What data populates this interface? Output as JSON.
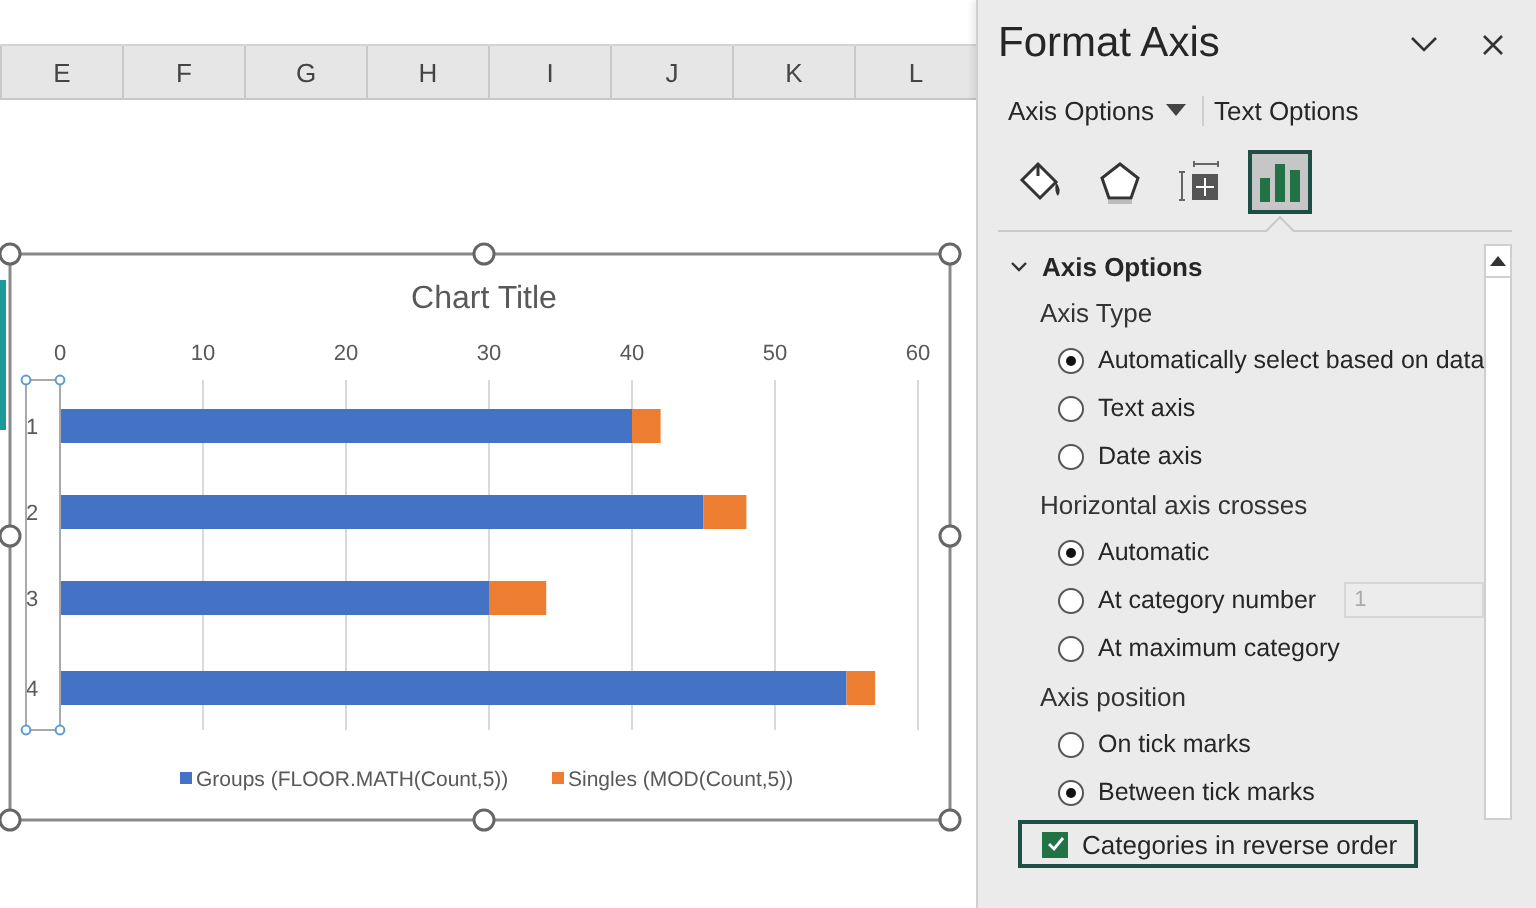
{
  "sheet": {
    "column_headers": [
      "E",
      "F",
      "G",
      "H",
      "I",
      "J",
      "K",
      "L"
    ]
  },
  "chart": {
    "selected": true,
    "chart_data": {
      "type": "bar",
      "orientation": "horizontal",
      "stacked": true,
      "title": "Chart Title",
      "categories": [
        "1",
        "2",
        "3",
        "4"
      ],
      "xlim": [
        0,
        60
      ],
      "xticks": [
        0,
        10,
        20,
        30,
        40,
        50,
        60
      ],
      "grid": true,
      "legend": true,
      "series": [
        {
          "name": "Groups (FLOOR.MATH(Count,5))",
          "color": "#4472c4",
          "values": [
            40,
            45,
            30,
            55
          ]
        },
        {
          "name": "Singles (MOD(Count,5))",
          "color": "#ed7d31",
          "values": [
            2,
            3,
            4,
            2
          ]
        }
      ]
    }
  },
  "panel": {
    "title": "Format Axis",
    "tabs": [
      {
        "label": "Axis Options",
        "dropdown": true
      },
      {
        "label": "Text Options",
        "dropdown": false
      }
    ],
    "icon_tabs": [
      {
        "kind": "fill",
        "selected": false
      },
      {
        "kind": "effects",
        "selected": false
      },
      {
        "kind": "size",
        "selected": false
      },
      {
        "kind": "axis",
        "selected": true
      }
    ],
    "section": {
      "title": "Axis Options",
      "expanded": true,
      "items": [
        {
          "kind": "label",
          "text": "Axis Type"
        },
        {
          "kind": "radio",
          "label": "Automatically select based on data",
          "selected": true
        },
        {
          "kind": "radio",
          "label": "Text axis",
          "selected": false
        },
        {
          "kind": "radio",
          "label": "Date axis",
          "selected": false
        },
        {
          "kind": "label",
          "text": "Horizontal axis crosses"
        },
        {
          "kind": "radio",
          "label": "Automatic",
          "selected": true
        },
        {
          "kind": "radio",
          "label": "At category number",
          "selected": false,
          "input": {
            "value": "1",
            "disabled": true
          }
        },
        {
          "kind": "radio",
          "label": "At maximum category",
          "selected": false
        },
        {
          "kind": "label",
          "text": "Axis position"
        },
        {
          "kind": "radio",
          "label": "On tick marks",
          "selected": false
        },
        {
          "kind": "radio",
          "label": "Between tick marks",
          "selected": true
        },
        {
          "kind": "checkbox",
          "label": "Categories in reverse order",
          "checked": true,
          "focused": true
        }
      ]
    }
  }
}
